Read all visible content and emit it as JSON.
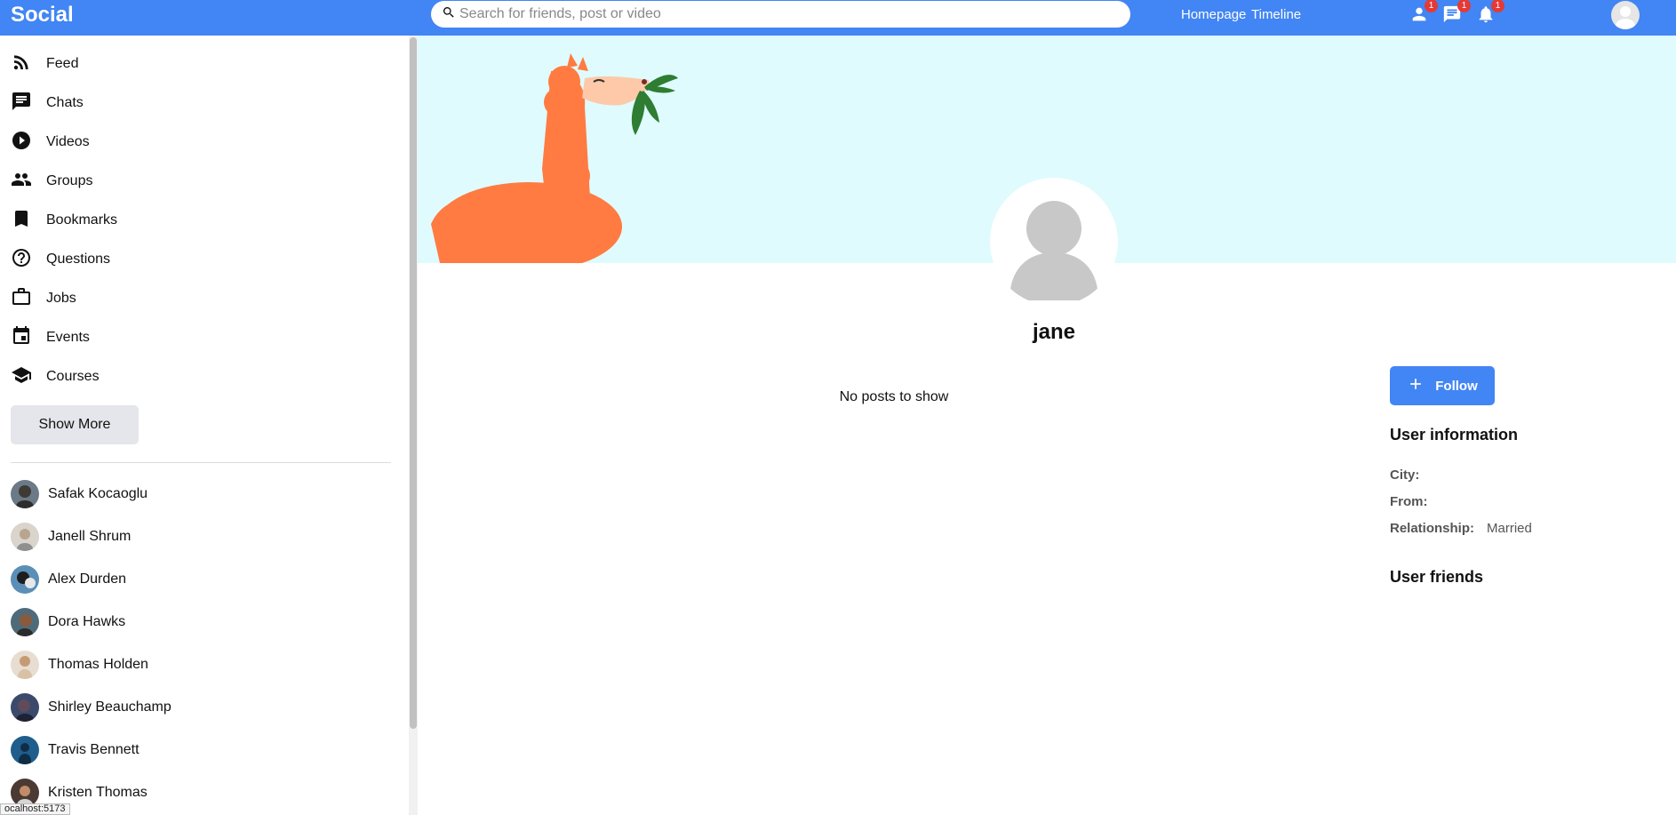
{
  "topbar": {
    "logo": "Social",
    "search_placeholder": "Search for friends, post or video",
    "links": [
      "Homepage",
      "Timeline"
    ],
    "badges": {
      "friends": "1",
      "messages": "1",
      "notifications": "1"
    }
  },
  "sidebar": {
    "items": [
      {
        "label": "Feed",
        "icon": "rss-feed-icon"
      },
      {
        "label": "Chats",
        "icon": "chat-icon"
      },
      {
        "label": "Videos",
        "icon": "play-circle-icon"
      },
      {
        "label": "Groups",
        "icon": "group-icon"
      },
      {
        "label": "Bookmarks",
        "icon": "bookmark-icon"
      },
      {
        "label": "Questions",
        "icon": "help-circle-icon"
      },
      {
        "label": "Jobs",
        "icon": "briefcase-icon"
      },
      {
        "label": "Events",
        "icon": "calendar-icon"
      },
      {
        "label": "Courses",
        "icon": "school-icon"
      }
    ],
    "show_more": "Show More",
    "friends": [
      {
        "name": "Safak Kocaoglu",
        "color": "#6b7a86"
      },
      {
        "name": "Janell Shrum",
        "color": "#d9d4cc"
      },
      {
        "name": "Alex Durden",
        "color": "#5b8fb8"
      },
      {
        "name": "Dora Hawks",
        "color": "#4f6b7a"
      },
      {
        "name": "Thomas Holden",
        "color": "#e7ddd0"
      },
      {
        "name": "Shirley Beauchamp",
        "color": "#3b4a6b"
      },
      {
        "name": "Travis Bennett",
        "color": "#1f5e8c"
      },
      {
        "name": "Kristen Thomas",
        "color": "#4a3a33"
      }
    ]
  },
  "status_tip": "ocalhost:5173",
  "profile": {
    "name": "jane",
    "no_posts": "No posts to show",
    "follow_label": "Follow",
    "info_title": "User information",
    "info": [
      {
        "key": "City:",
        "value": ""
      },
      {
        "key": "From:",
        "value": ""
      },
      {
        "key": "Relationship:",
        "value": "Married"
      }
    ],
    "friends_title": "User friends"
  },
  "colors": {
    "brand": "#4285f4",
    "cover": "#dffbfd",
    "llama": "#ff7b42",
    "badge": "#e53935"
  }
}
